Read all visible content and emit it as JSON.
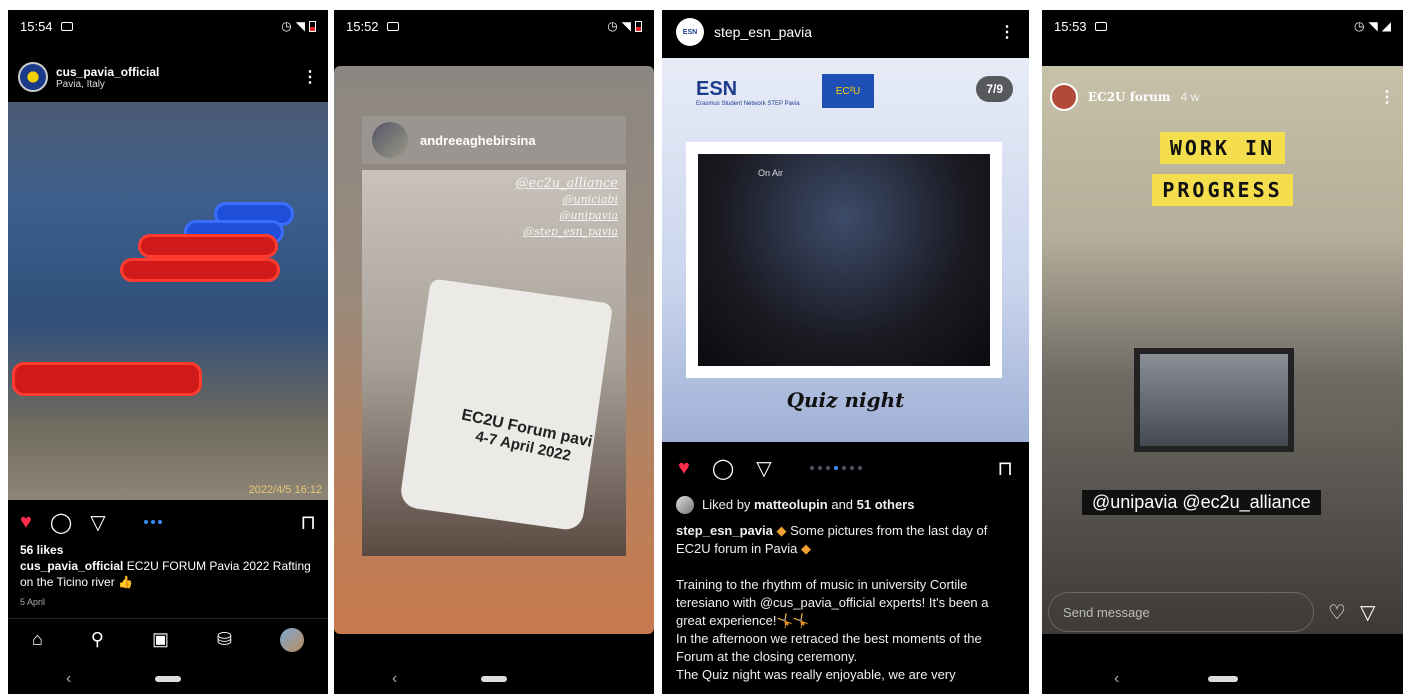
{
  "panel1": {
    "status": {
      "time": "15:54"
    },
    "post": {
      "username": "cus_pavia_official",
      "location": "Pavia, Italy",
      "photo_stamp": "2022/4/5 16:12",
      "likes": "56 likes",
      "caption_user": "cus_pavia_official",
      "caption_text": "EC2U FORUM Pavia 2022 Rafting on the Ticino river 👍",
      "date": "5 April"
    },
    "icons": {
      "heart": "♥",
      "comment": "◯",
      "share": "▽",
      "bookmark": "⊓",
      "kebab": "⋮",
      "home": "⌂",
      "search": "⚲",
      "reels": "▣",
      "shop": "⛁",
      "back": "‹"
    }
  },
  "panel2": {
    "status": {
      "time": "15:52"
    },
    "story": {
      "username": "andreeaghebirsina",
      "tags": [
        "@ec2u_alliance",
        "@uniciabi",
        "@unipavia",
        "@step_esn_pavia"
      ],
      "bag_line1": "EC2U Forum pavi",
      "bag_line2": "4-7 April 2022"
    }
  },
  "panel3": {
    "header": {
      "avatar_text": "ESN",
      "username": "step_esn_pavia",
      "kebab": "⋮"
    },
    "image": {
      "esn_logo": "ESN",
      "esn_logo_sub": "Erasmus Student Network STEP Pavia",
      "flag_text": "EC²U",
      "pager": "7/9",
      "on_air": "On Air",
      "title": "Quiz night"
    },
    "liked_prefix": "Liked by",
    "liked_user": "matteolupin",
    "liked_and": "and",
    "liked_others": "51 others",
    "caption_user": "step_esn_pavia",
    "caption_line1": "Some pictures from the last day of EC2U forum in Pavia",
    "caption_p1": "Training to the rhythm of music in university Cortile teresiano with @cus_pavia_official experts! It's been a great experience!🤸🤸",
    "caption_p2": "In the afternoon we retraced the best moments of the Forum at the closing ceremony.",
    "caption_p3": "The Quiz night was really enjoyable, we are very"
  },
  "panel4": {
    "status": {
      "time": "15:53"
    },
    "story": {
      "username": "EC2U forum",
      "time_ago": "4 w",
      "wip_line1": "WORK IN",
      "wip_line2": "PROGRESS",
      "tags": "@unipavia @ec2u_alliance"
    },
    "message_placeholder": "Send message"
  }
}
